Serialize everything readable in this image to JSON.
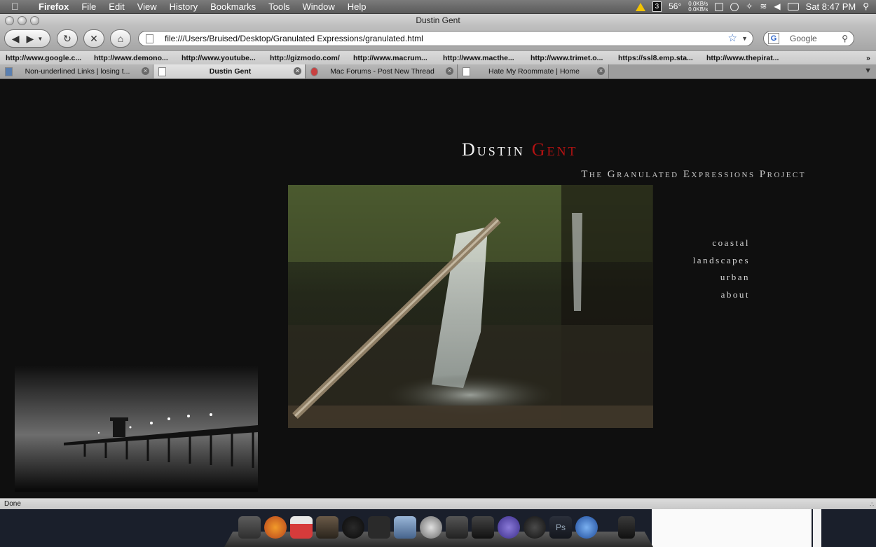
{
  "menubar": {
    "app": "Firefox",
    "menus": [
      "File",
      "Edit",
      "View",
      "History",
      "Bookmarks",
      "Tools",
      "Window",
      "Help"
    ],
    "badge": "3",
    "temperature": "56°",
    "net_up": "0.0KB/s",
    "net_down": "0.0KB/s",
    "clock": "Sat 8:47 PM"
  },
  "window": {
    "title": "Dustin Gent"
  },
  "toolbar": {
    "url": "file:///Users/Bruised/Desktop/Granulated Expressions/granulated.html",
    "search_placeholder": "Google"
  },
  "bookmarks": [
    "http://www.google.c...",
    "http://www.demono...",
    "http://www.youtube...",
    "http://gizmodo.com/",
    "http://www.macrum...",
    "http://www.macthe...",
    "http://www.trimet.o...",
    "https://ssl8.emp.sta...",
    "http://www.thepirat..."
  ],
  "tabs": [
    {
      "label": "Non-underlined Links | losing t...",
      "active": false
    },
    {
      "label": "Dustin Gent",
      "active": true
    },
    {
      "label": "Mac Forums - Post New Thread",
      "active": false
    },
    {
      "label": "Hate My Roommate | Home",
      "active": false
    }
  ],
  "site": {
    "first_name": "Dustin",
    "last_name": "Gent",
    "subtitle": "The Granulated Expressions Project",
    "nav": [
      "coastal",
      "landscapes",
      "urban",
      "about"
    ],
    "accent_color": "#b21212",
    "hero_image": "waterfall-photo",
    "thumb_image": "pier-photo"
  },
  "status": {
    "text": "Done"
  },
  "colors": {
    "page_bg": "#0f0f0f",
    "accent": "#b21212",
    "nav_text": "#d8d8d8"
  }
}
